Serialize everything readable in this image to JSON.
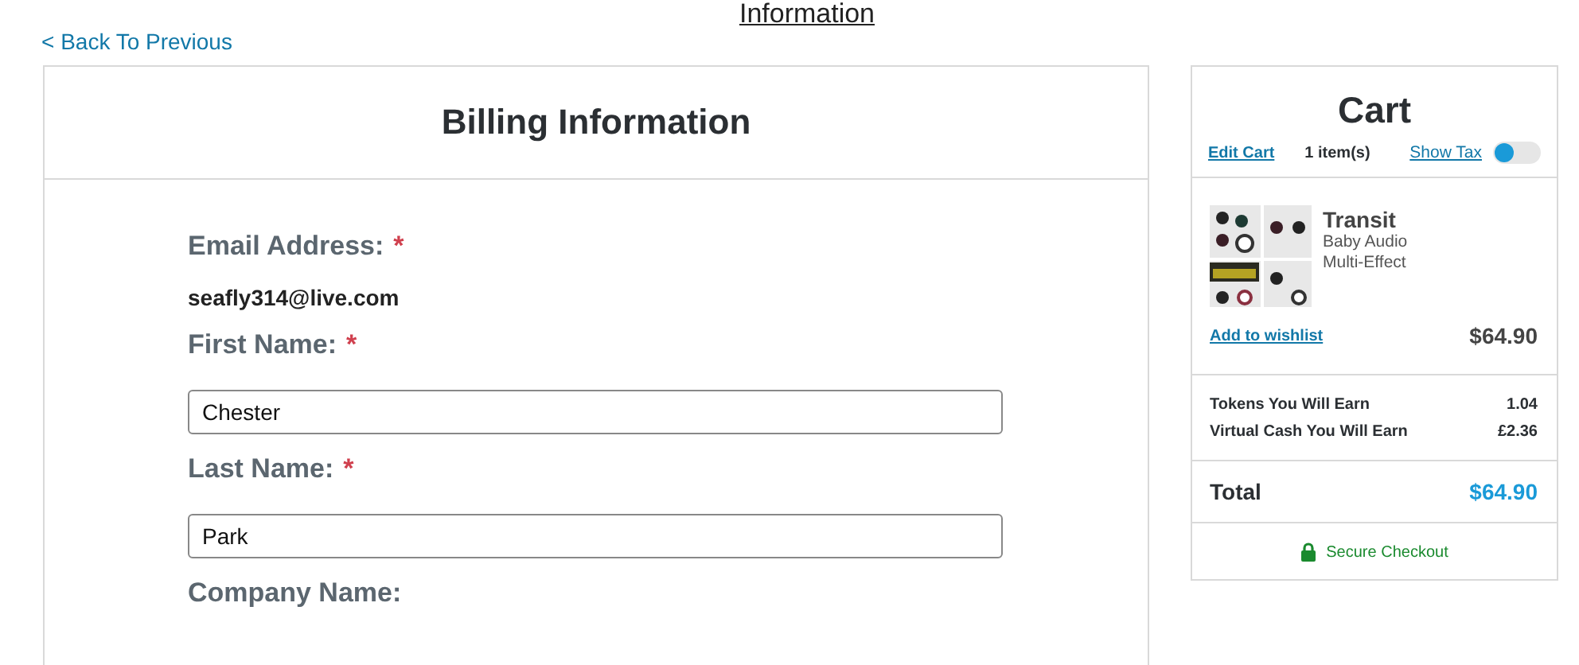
{
  "page_heading": "Information",
  "back_link": "< Back To Previous",
  "billing": {
    "title": "Billing Information",
    "fields": [
      {
        "kind": "text",
        "label": "Email Address:",
        "required_mark": "*",
        "value": "seafly314@live.com"
      },
      {
        "kind": "input",
        "label": "First Name:",
        "required_mark": "*",
        "value": "Chester"
      },
      {
        "kind": "input",
        "label": "Last Name:",
        "required_mark": "*",
        "value": "Park"
      },
      {
        "kind": "label",
        "label": "Company Name:"
      }
    ]
  },
  "cart": {
    "title": "Cart",
    "edit_link": "Edit Cart",
    "count": "1 item(s)",
    "tax_toggle": {
      "label": "Show Tax",
      "on": false
    },
    "items": [
      {
        "name": "Transit",
        "brand": "Baby Audio",
        "type": "Multi-Effect",
        "wishlist_link": "Add to wishlist",
        "price": "$64.90"
      }
    ],
    "earnings": [
      {
        "label": "Tokens You Will Earn",
        "value": "1.04"
      },
      {
        "label": "Virtual Cash You Will Earn",
        "value": "£2.36"
      }
    ],
    "total_label": "Total",
    "total": "$64.90",
    "secure": "Secure Checkout"
  }
}
